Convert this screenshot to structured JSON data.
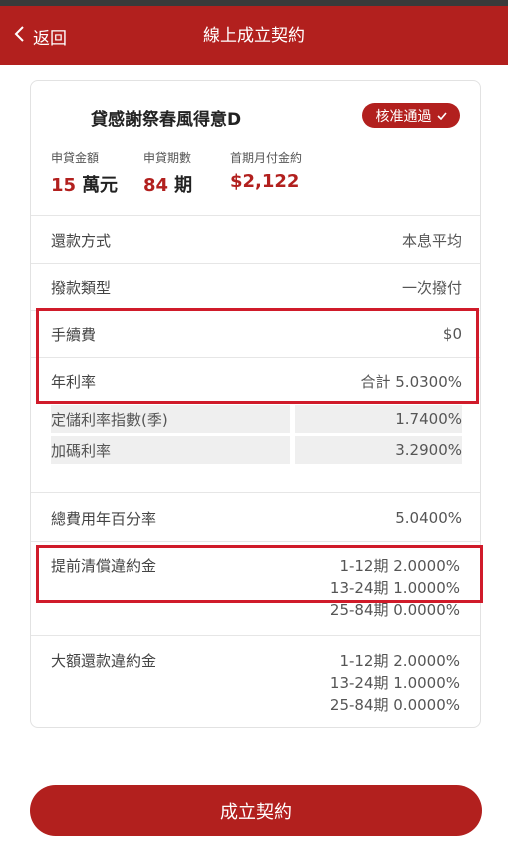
{
  "header": {
    "back_label": "返回",
    "title": "線上成立契約"
  },
  "product": {
    "name": "貸感謝祭春風得意D",
    "status_badge": "核准通過"
  },
  "summary": [
    {
      "label": "申貸金額",
      "value": "15",
      "unit": "萬元"
    },
    {
      "label": "申貸期數",
      "value": "84",
      "unit": "期"
    },
    {
      "label": "首期月付金約",
      "value": "$2,122",
      "unit": ""
    }
  ],
  "details": {
    "repayment": {
      "label": "還款方式",
      "value": "本息平均"
    },
    "disbursement": {
      "label": "撥款類型",
      "value": "一次撥付"
    },
    "fee": {
      "label": "手續費",
      "value": "$0"
    },
    "annual_rate": {
      "label": "年利率",
      "value": "合計 5.0300%"
    },
    "base_rate": {
      "label": "定儲利率指數(季)",
      "value": "1.7400%"
    },
    "add_rate": {
      "label": "加碼利率",
      "value": "3.2900%"
    },
    "apr": {
      "label": "總費用年百分率",
      "value": "5.0400%"
    },
    "prepayment_penalty": {
      "label": "提前清償違約金",
      "values": [
        "1-12期 2.0000%",
        "13-24期 1.0000%",
        "25-84期 0.0000%"
      ]
    },
    "large_repayment_penalty": {
      "label": "大額還款違約金",
      "values": [
        "1-12期 2.0000%",
        "13-24期 1.0000%",
        "25-84期 0.0000%"
      ]
    }
  },
  "action": {
    "submit_label": "成立契約"
  },
  "colors": {
    "brand": "#b2201e",
    "highlight_box": "#d01b2a"
  }
}
